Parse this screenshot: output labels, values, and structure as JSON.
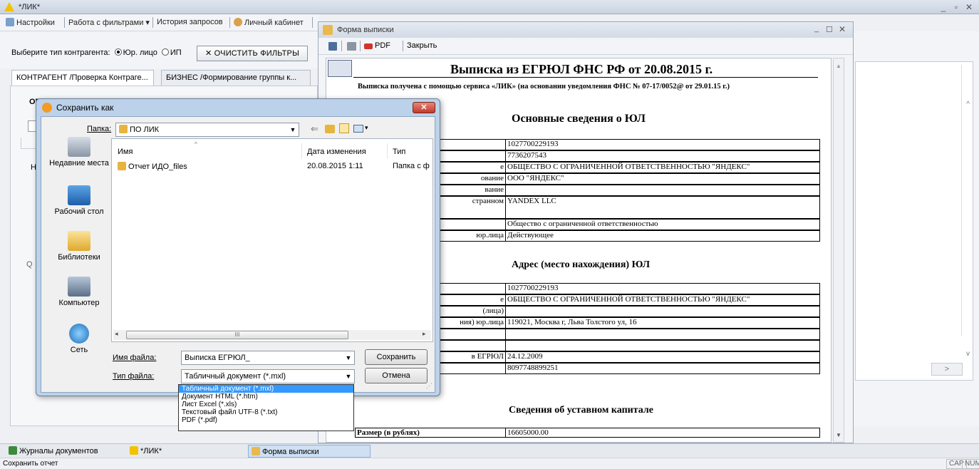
{
  "app": {
    "title": "*ЛИК*"
  },
  "toolbar": {
    "settings": "Настройки",
    "filters": "Работа с фильтрами ▾",
    "history": "История запросов",
    "cabinet": "Личный кабинет"
  },
  "filter": {
    "label": "Выберите тип контрагента:",
    "opt1": "Юр. лицо",
    "opt2": "ИП",
    "clear": "✕  ОЧИСТИТЬ ФИЛЬТРЫ"
  },
  "tabs": [
    "КОНТРАГЕНТ /Проверка Контраге...",
    "БИЗНЕС /Формирование группы к..."
  ],
  "form": {
    "title": "Форма выписки",
    "pdf": "PDF",
    "close": "Закрыть"
  },
  "document": {
    "heading": "Выписка из ЕГРЮЛ ФНС РФ от 20.08.2015 г.",
    "subheading": "Выписка получена с помощью сервиса «ЛИК» (на основании уведомления ФНС № 07-17/0052@ от 29.01.15 г.)",
    "section1": "Основные сведения о ЮЛ",
    "section2": "Адрес (место нахождения) ЮЛ",
    "section3": "Сведения об уставном капитале",
    "rows1": [
      {
        "label": "",
        "value": "1027700229193"
      },
      {
        "label": "",
        "value": "7736207543"
      },
      {
        "label": "е",
        "value": "ОБЩЕСТВО С ОГРАНИЧЕННОЙ ОТВЕТСТВЕННОСТЬЮ \"ЯНДЕКС\""
      },
      {
        "label": "ование",
        "value": "ООО \"ЯНДЕКС\""
      },
      {
        "label": "вание",
        "value": ""
      },
      {
        "label": "странном",
        "value": "YANDEX LLC"
      },
      {
        "label": "",
        "value": "Общество с ограниченной ответственностью"
      },
      {
        "label": "юр.лица",
        "value": "Действующее"
      }
    ],
    "rows2": [
      {
        "label": "",
        "value": "1027700229193"
      },
      {
        "label": "е",
        "value": "ОБЩЕСТВО С ОГРАНИЧЕННОЙ ОТВЕТСТВЕННОСТЬЮ \"ЯНДЕКС\""
      },
      {
        "label": "(лица)",
        "value": ""
      },
      {
        "label": "ния) юр.лица",
        "value": "119021, Москва г, Льва Толстого ул, 16"
      },
      {
        "label": "",
        "value": ""
      },
      {
        "label": "",
        "value": ""
      },
      {
        "label": "в ЕГРЮЛ",
        "value": "24.12.2009"
      },
      {
        "label": "",
        "value": "8097748899251"
      }
    ],
    "capital_label": "Размер (в рублях)",
    "capital_value": "16605000.00"
  },
  "left_fragments": {
    "a": "ОГ",
    "b": "Н",
    "c": "Q"
  },
  "dialog": {
    "title": "Сохранить как",
    "folder_label": "Папка:",
    "folder_value": "ПО ЛИК",
    "places": [
      "Недавние места",
      "Рабочий стол",
      "Библиотеки",
      "Компьютер",
      "Сеть"
    ],
    "columns": [
      "Имя",
      "Дата изменения",
      "Тип"
    ],
    "files": [
      {
        "name": "Отчет ИДО_files",
        "date": "20.08.2015 1:11",
        "type": "Папка с ф"
      }
    ],
    "filename_label": "Имя файла:",
    "filename_value": "Выписка ЕГРЮЛ_",
    "filetype_label": "Тип файла:",
    "filetype_value": "Табличный документ (*.mxl)",
    "save": "Сохранить",
    "cancel": "Отмена",
    "scroll_mid": "III",
    "types": [
      "Табличный документ (*.mxl)",
      "Документ HTML (*.htm)",
      "Лист Excel (*.xls)",
      "Текстовый файл UTF-8 (*.txt)",
      "PDF (*.pdf)"
    ]
  },
  "taskbar": [
    "Журналы документов",
    "*ЛИК*",
    "Форма выписки"
  ],
  "status": {
    "text": "Сохранить отчет",
    "cap": "CAP",
    "num": "NUM"
  }
}
